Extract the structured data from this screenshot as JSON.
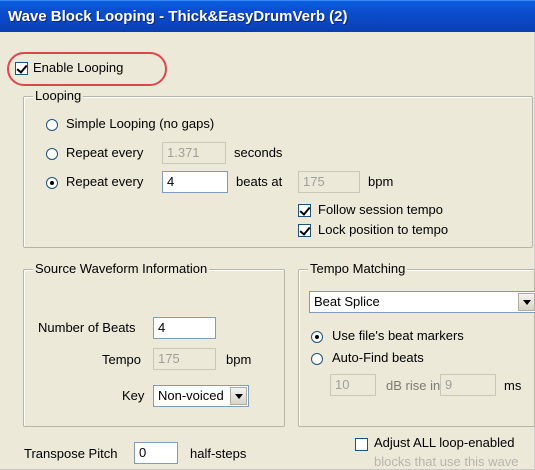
{
  "window": {
    "title": "Wave Block Looping - Thick&EasyDrumVerb (2)"
  },
  "enable_looping": {
    "label": "Enable Looping",
    "checked": true
  },
  "looping": {
    "group_label": "Looping",
    "simple": {
      "label": "Simple Looping (no gaps)",
      "selected": false
    },
    "repeat_seconds": {
      "label": "Repeat every",
      "value": "1.371",
      "unit": "seconds",
      "selected": false
    },
    "repeat_beats": {
      "label": "Repeat every",
      "value": "4",
      "beats_at": "beats at",
      "bpm_value": "175",
      "bpm_unit": "bpm",
      "selected": true
    },
    "follow_tempo": {
      "label": "Follow session tempo",
      "checked": true
    },
    "lock_position": {
      "label": "Lock position to tempo",
      "checked": true
    }
  },
  "source_waveform": {
    "group_label": "Source Waveform Information",
    "number_of_beats": {
      "label": "Number of Beats",
      "value": "4"
    },
    "tempo": {
      "label": "Tempo",
      "value": "175",
      "unit": "bpm"
    },
    "key": {
      "label": "Key",
      "value": "Non-voiced"
    }
  },
  "tempo_matching": {
    "group_label": "Tempo Matching",
    "method": "Beat Splice",
    "use_markers": {
      "label": "Use file's beat markers",
      "selected": true
    },
    "auto_find": {
      "label": "Auto-Find beats",
      "selected": false
    },
    "db_rise": {
      "value": "10",
      "label": "dB rise in",
      "ms_value": "9",
      "ms_unit": "ms"
    }
  },
  "transpose": {
    "label": "Transpose Pitch",
    "value": "0",
    "unit": "half-steps"
  },
  "adjust_all": {
    "checked": false,
    "line1": "Adjust ALL loop-enabled",
    "line2": "blocks that use this wave"
  }
}
